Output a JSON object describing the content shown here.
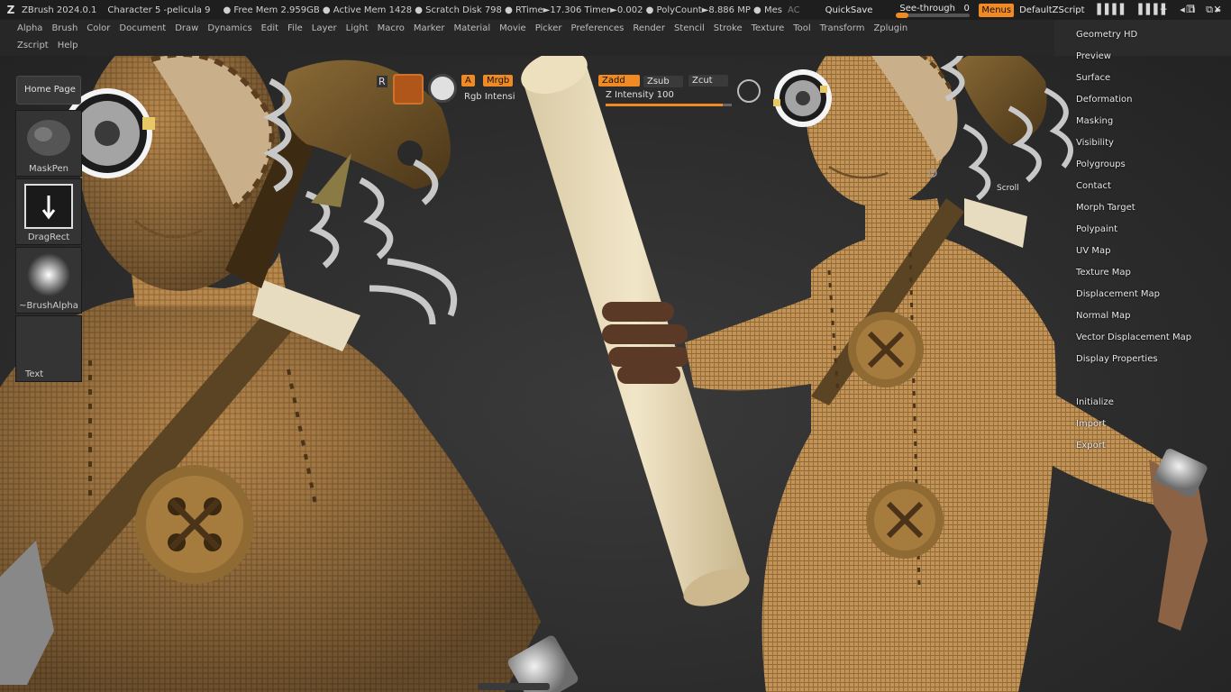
{
  "titlebar": {
    "app": "ZBrush 2024.0.1",
    "document": "Character 5 -pelicula 9",
    "stats": "● Free Mem 2.959GB ● Active Mem 1428 ● Scratch Disk 798 ● RTime►17.306 Timer►0.002 ● PolyCount►8.886 MP ● Mes",
    "ac": "AC",
    "quicksave": "QuickSave",
    "see_through_label": "See-through",
    "see_through_value": "0",
    "menus": "Menus",
    "default_zscript": "DefaultZScript"
  },
  "menubar": {
    "row1": [
      "Alpha",
      "Brush",
      "Color",
      "Document",
      "Draw",
      "Dynamics",
      "Edit",
      "File",
      "Layer",
      "Light",
      "Macro",
      "Marker",
      "Material",
      "Movie",
      "Picker",
      "Preferences",
      "Render",
      "Stencil",
      "Stroke",
      "Texture",
      "Tool",
      "Transform",
      "Zplugin"
    ],
    "row2": [
      "Zscript",
      "Help"
    ]
  },
  "shelf": {
    "home": "Home Page",
    "items": [
      "MaskPen",
      "DragRect",
      "~BrushAlpha",
      "Text"
    ]
  },
  "draw": {
    "a": "A",
    "mrgb": "Mrgb",
    "rgb_intensity": "Rgb Intensi",
    "zadd": "Zadd",
    "zsub": "Zsub",
    "zcut": "Zcut",
    "z_intensity": "Z Intensity 100",
    "z_intensity_fraction": 0.93,
    "r": "R",
    "scroll": "Scroll"
  },
  "tool_menu": [
    "Geometry HD",
    "Preview",
    "Surface",
    "Deformation",
    "Masking",
    "Visibility",
    "Polygroups",
    "Contact",
    "Morph Target",
    "Polypaint",
    "UV Map",
    "Texture Map",
    "Displacement Map",
    "Normal Map",
    "Vector Displacement Map",
    "Display Properties",
    "",
    "Initialize",
    "Import",
    "Export"
  ],
  "colors": {
    "accent": "#f08a24",
    "background": "#2b2b2b",
    "burlap": "#b8884e",
    "strap": "#5b4423"
  }
}
